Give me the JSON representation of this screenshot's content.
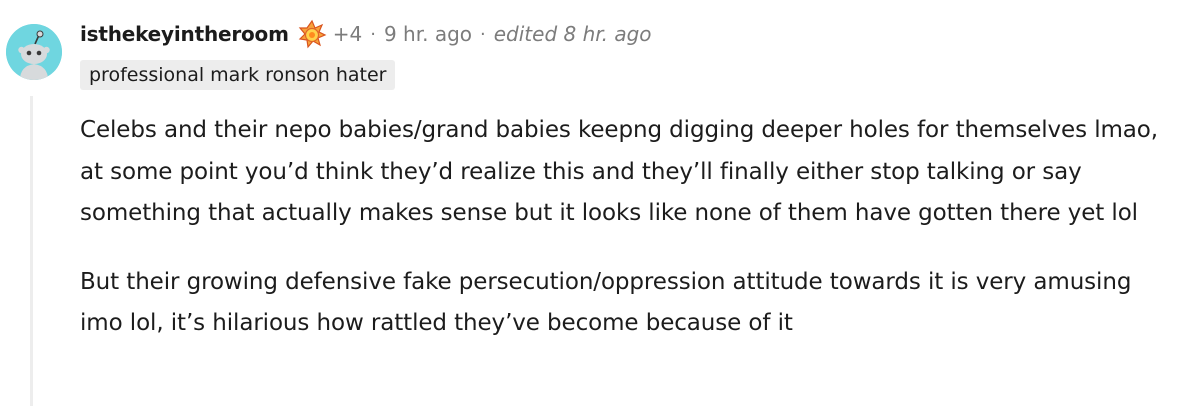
{
  "comment": {
    "username": "isthekeyintheroom",
    "award_icon": "award-icon",
    "score": "+4",
    "separator": "·",
    "time_ago": "9 hr. ago",
    "edited": "edited 8 hr. ago",
    "flair": "professional mark ronson hater",
    "paragraphs": [
      "Celebs and their nepo babies/grand babies keepng digging deeper holes for themselves lmao, at some point you’d think they’d realize this and they’ll finally either stop talking or say something that actually makes sense but it looks like none of them have gotten there yet lol",
      "But their growing defensive fake persecution/oppression attitude towards it is very amusing imo lol, it’s hilarious how rattled they’ve become because of it"
    ]
  },
  "colors": {
    "avatar_bg": "#6fd6e0",
    "meta_text": "#7c7c7c",
    "flair_bg": "#ededed",
    "thread_line": "#ededed"
  }
}
